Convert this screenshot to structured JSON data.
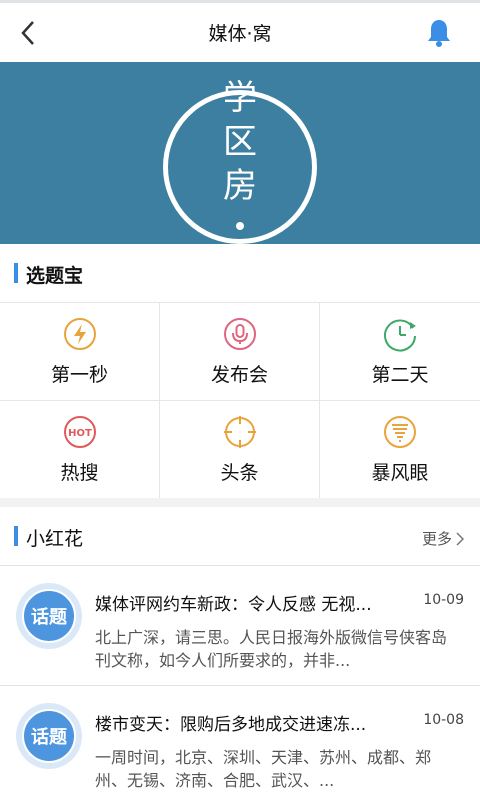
{
  "header": {
    "title": "媒体·窝",
    "back_icon": "back-arrow-icon",
    "bell_icon": "bell-icon",
    "accent_color": "#3a8ee6"
  },
  "banner": {
    "text": [
      "学",
      "区",
      "房"
    ],
    "background": "#3d7fa0"
  },
  "topics_section": {
    "title": "选题宝",
    "items": [
      {
        "label": "第一秒",
        "icon": "lightning-icon",
        "color": "#e8a33d"
      },
      {
        "label": "发布会",
        "icon": "microphone-icon",
        "color": "#e0657f"
      },
      {
        "label": "第二天",
        "icon": "clock-refresh-icon",
        "color": "#3ea86a"
      },
      {
        "label": "热搜",
        "icon": "hot-icon",
        "color": "#e05a5a"
      },
      {
        "label": "头条",
        "icon": "crosshair-icon",
        "color": "#e8a33d"
      },
      {
        "label": "暴风眼",
        "icon": "tornado-icon",
        "color": "#e8a33d"
      }
    ]
  },
  "flowers_section": {
    "title": "小红花",
    "more_label": "更多"
  },
  "news": [
    {
      "badge": "话题",
      "title": "媒体评网约车新政：令人反感 无视...",
      "date": "10-09",
      "summary": "北上广深，请三思。人民日报海外版微信号侠客岛刊文称，如今人们所要求的，并非..."
    },
    {
      "badge": "话题",
      "title": "楼市变天：限购后多地成交进速冻...",
      "date": "10-08",
      "summary": "一周时间，北京、深圳、天津、苏州、成都、郑州、无锡、济南、合肥、武汉、..."
    }
  ]
}
